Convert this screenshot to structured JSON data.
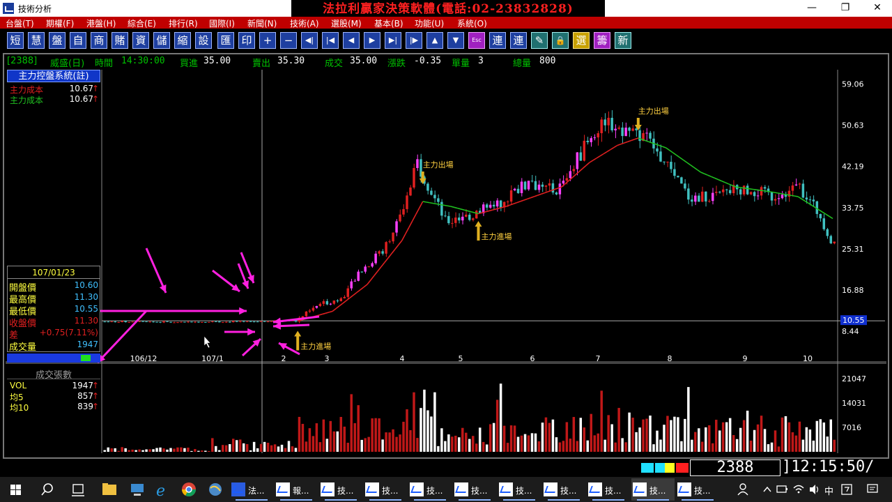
{
  "window": {
    "title": "技術分析",
    "banner": "法拉利贏家決策軟體(電話:02-23832828)",
    "minimize": "—",
    "restore": "❐",
    "close": "✕"
  },
  "menu": [
    "台盤(T)",
    "期權(F)",
    "港盤(H)",
    "綜合(E)",
    "排行(R)",
    "國際(I)",
    "新聞(N)",
    "技術(A)",
    "選股(M)",
    "基本(B)",
    "功能(U)",
    "系統(O)"
  ],
  "toolbar": [
    "短",
    "慧",
    "盤",
    "自",
    "商",
    "賭",
    "資",
    "儲",
    "縮",
    "設",
    "匯",
    "印",
    "+",
    "−",
    "◀|",
    "|◀",
    "◀",
    "▶",
    "▶|",
    "|▶",
    "▲",
    "▼",
    "Esc",
    "連",
    "連",
    "✎",
    "🔒",
    "選",
    "籌",
    "新"
  ],
  "infobar": {
    "code": "[2388]",
    "name": "威盛(日)",
    "time_label": "時間",
    "time_value": "14:30:00",
    "bid_label": "買進",
    "bid_value": "35.00",
    "ask_label": "賣出",
    "ask_value": "35.30",
    "trade_label": "成交",
    "trade_value": "35.00",
    "change_label": "漲跌",
    "change_value": "-0.35",
    "unit_label": "單量",
    "unit_value": "3",
    "total_label": "總量",
    "total_value": "800"
  },
  "indicator": {
    "header": "主力控盤系統(註)",
    "line1_label": "主力成本",
    "line1_value": "10.67",
    "line2_label": "主力成本",
    "line2_value": "10.67",
    "arrow": "↑"
  },
  "datebox": {
    "date": "107/01/23",
    "rows": [
      {
        "label": "開盤價",
        "value": "10.60"
      },
      {
        "label": "最高價",
        "value": "11.30"
      },
      {
        "label": "最低價",
        "value": "10.55"
      },
      {
        "label": "收盤價",
        "value": "11.30"
      },
      {
        "label": "差",
        "value": "+0.75(7.11%)"
      },
      {
        "label": "成交量",
        "value": "1947"
      }
    ]
  },
  "volume_panel": {
    "header": "成交張數",
    "rows": [
      {
        "label": "VOL",
        "value": "1947"
      },
      {
        "label": "均5",
        "value": "857"
      },
      {
        "label": "均10",
        "value": "839"
      }
    ]
  },
  "colors": {
    "up": "#e02020",
    "down": "#40c0c0",
    "pink": "#ff40ff",
    "ma_red": "#e02020",
    "ma_green": "#20c020",
    "arrow_gold": "#e0b020",
    "annotation_magenta": "#ff20e0"
  },
  "chart_data": {
    "type": "candlestick",
    "price_axis_ticks": [
      "59.06",
      "50.63",
      "42.19",
      "33.75",
      "25.31",
      "16.88",
      "8.44"
    ],
    "price_current": "10.55",
    "ylim": [
      4,
      62
    ],
    "x_ticks": [
      "106/12",
      "107/1",
      "2",
      "3",
      "4",
      "5",
      "6",
      "7",
      "8",
      "9",
      "10"
    ],
    "volume_axis_ticks": [
      "21047",
      "14031",
      "7016"
    ],
    "volume_ylim": [
      0,
      24000
    ],
    "annotations": [
      {
        "text": "主力進場",
        "kind": "enter",
        "period": 56,
        "price": 10.5
      },
      {
        "text": "主力出場",
        "kind": "exit",
        "period": 92,
        "price": 38
      },
      {
        "text": "主力進場",
        "kind": "enter",
        "period": 108,
        "price": 33
      },
      {
        "text": "主力出場",
        "kind": "exit",
        "period": 154,
        "price": 49
      }
    ],
    "price_series": [
      {
        "p": 0,
        "c": 10.4
      },
      {
        "p": 20,
        "c": 10.3
      },
      {
        "p": 40,
        "c": 10.4
      },
      {
        "p": 55,
        "c": 10.6
      },
      {
        "p": 62,
        "c": 14
      },
      {
        "p": 68,
        "c": 15
      },
      {
        "p": 74,
        "c": 21
      },
      {
        "p": 80,
        "c": 25
      },
      {
        "p": 86,
        "c": 33
      },
      {
        "p": 90,
        "c": 43
      },
      {
        "p": 94,
        "c": 37
      },
      {
        "p": 98,
        "c": 31
      },
      {
        "p": 102,
        "c": 31
      },
      {
        "p": 108,
        "c": 33
      },
      {
        "p": 114,
        "c": 35
      },
      {
        "p": 122,
        "c": 39
      },
      {
        "p": 130,
        "c": 37
      },
      {
        "p": 138,
        "c": 46
      },
      {
        "p": 144,
        "c": 52
      },
      {
        "p": 150,
        "c": 49
      },
      {
        "p": 156,
        "c": 48
      },
      {
        "p": 162,
        "c": 42
      },
      {
        "p": 168,
        "c": 36
      },
      {
        "p": 176,
        "c": 36
      },
      {
        "p": 184,
        "c": 38
      },
      {
        "p": 192,
        "c": 36
      },
      {
        "p": 200,
        "c": 38
      },
      {
        "p": 206,
        "c": 32
      },
      {
        "p": 209,
        "c": 27
      }
    ],
    "ma_series": [
      {
        "p": 56,
        "v": 10.5
      },
      {
        "p": 66,
        "v": 12.5
      },
      {
        "p": 76,
        "v": 18
      },
      {
        "p": 86,
        "v": 27
      },
      {
        "p": 92,
        "v": 35
      },
      {
        "p": 100,
        "v": 34
      },
      {
        "p": 108,
        "v": 32.5
      },
      {
        "p": 116,
        "v": 34
      },
      {
        "p": 124,
        "v": 36
      },
      {
        "p": 132,
        "v": 38
      },
      {
        "p": 140,
        "v": 43
      },
      {
        "p": 148,
        "v": 46.5
      },
      {
        "p": 154,
        "v": 48
      },
      {
        "p": 162,
        "v": 46
      },
      {
        "p": 172,
        "v": 41
      },
      {
        "p": 182,
        "v": 38
      },
      {
        "p": 192,
        "v": 37
      },
      {
        "p": 200,
        "v": 36
      },
      {
        "p": 210,
        "v": 31.5
      }
    ],
    "ma_color_switch": [
      {
        "p": 92,
        "color": "green"
      },
      {
        "p": 108,
        "color": "red"
      },
      {
        "p": 154,
        "color": "green"
      }
    ]
  },
  "status": {
    "code": "2388",
    "clock": "]12:15:50/"
  },
  "taskbar": {
    "apps": [
      "法...",
      "報...",
      "技...",
      "技...",
      "技...",
      "技...",
      "技...",
      "技...",
      "技...",
      "技...",
      "技..."
    ],
    "tray_ime": "中"
  }
}
